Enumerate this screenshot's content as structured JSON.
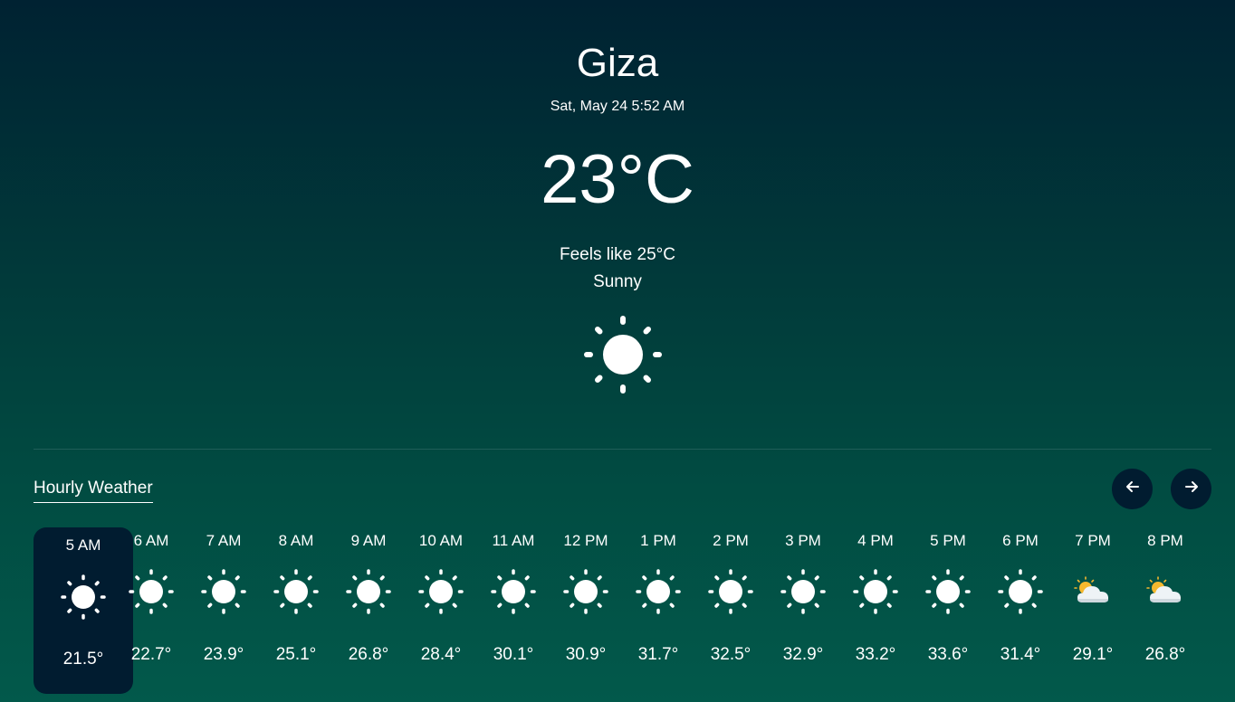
{
  "current": {
    "city": "Giza",
    "datetime": "Sat, May 24 5:52 AM",
    "temperature": "23°C",
    "feels_like": "Feels like 25°C",
    "condition": "Sunny",
    "icon": "sun-icon"
  },
  "hourly": {
    "title": "Hourly Weather",
    "prev_icon": "arrow-left-icon",
    "next_icon": "arrow-right-icon",
    "items": [
      {
        "time": "5 AM",
        "temp": "21.5°",
        "icon": "sun-icon",
        "selected": true
      },
      {
        "time": "6 AM",
        "temp": "22.7°",
        "icon": "sun-icon"
      },
      {
        "time": "7 AM",
        "temp": "23.9°",
        "icon": "sun-icon"
      },
      {
        "time": "8 AM",
        "temp": "25.1°",
        "icon": "sun-icon"
      },
      {
        "time": "9 AM",
        "temp": "26.8°",
        "icon": "sun-icon"
      },
      {
        "time": "10 AM",
        "temp": "28.4°",
        "icon": "sun-icon"
      },
      {
        "time": "11 AM",
        "temp": "30.1°",
        "icon": "sun-icon"
      },
      {
        "time": "12 PM",
        "temp": "30.9°",
        "icon": "sun-icon"
      },
      {
        "time": "1 PM",
        "temp": "31.7°",
        "icon": "sun-icon"
      },
      {
        "time": "2 PM",
        "temp": "32.5°",
        "icon": "sun-icon"
      },
      {
        "time": "3 PM",
        "temp": "32.9°",
        "icon": "sun-icon"
      },
      {
        "time": "4 PM",
        "temp": "33.2°",
        "icon": "sun-icon"
      },
      {
        "time": "5 PM",
        "temp": "33.6°",
        "icon": "sun-icon"
      },
      {
        "time": "6 PM",
        "temp": "31.4°",
        "icon": "sun-icon"
      },
      {
        "time": "7 PM",
        "temp": "29.1°",
        "icon": "partly-cloudy-icon"
      },
      {
        "time": "8 PM",
        "temp": "26.8°",
        "icon": "partly-cloudy-icon"
      }
    ]
  },
  "colors": {
    "background_top": "#002232",
    "background_bottom": "#02594b",
    "card": "#011c30",
    "text": "#ffffff"
  }
}
